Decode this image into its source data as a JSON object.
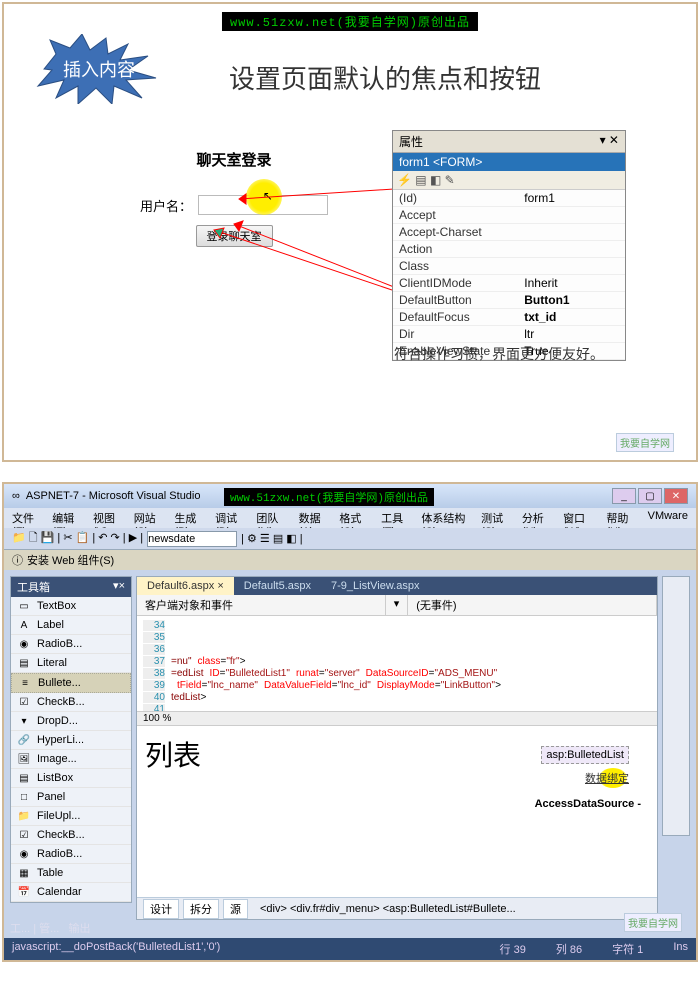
{
  "watermark": "www.51zxw.net(我要自学网)原创出品",
  "card1": {
    "burst": "插入内容",
    "title": "设置页面默认的焦点和按钮",
    "login_head": "聊天室登录",
    "user_label": "用户名：",
    "login_btn": "登录聊天室",
    "note": "符合操作习惯，界面更方便友好。",
    "logo": "我要自学网"
  },
  "props": {
    "title": "属性",
    "pin": "▾ ✕",
    "form": "form1 <FORM>",
    "tool": "⚡ ▤ ◧ ✎",
    "rows": [
      {
        "k": "(Id)",
        "v": "form1"
      },
      {
        "k": "Accept",
        "v": ""
      },
      {
        "k": "Accept-Charset",
        "v": ""
      },
      {
        "k": "Action",
        "v": ""
      },
      {
        "k": "Class",
        "v": ""
      },
      {
        "k": "ClientIDMode",
        "v": "Inherit"
      },
      {
        "k": "DefaultButton",
        "v": "Button1",
        "bold": true
      },
      {
        "k": "DefaultFocus",
        "v": "txt_id",
        "bold": true
      },
      {
        "k": "Dir",
        "v": "ltr"
      },
      {
        "k": "EnableViewState",
        "v": "True"
      }
    ]
  },
  "vs": {
    "title": "ASPNET-7 - Microsoft Visual Studio",
    "menus": [
      "文件(F)",
      "编辑(E)",
      "视图(V)",
      "网站(S)",
      "生成(B)",
      "调试(D)",
      "团队(M)",
      "数据(A)",
      "格式(O)",
      "工具(T)",
      "体系结构(C)",
      "测试(S)",
      "分析(N)",
      "窗口(W)",
      "帮助(H)",
      "VMware"
    ],
    "dropdown": "newsdate",
    "install": "安装 Web 组件(S)",
    "toolbox": "工具箱",
    "tbitems": [
      {
        "i": "▭",
        "t": "TextBox"
      },
      {
        "i": "A",
        "t": "Label"
      },
      {
        "i": "◉",
        "t": "RadioB..."
      },
      {
        "i": "▤",
        "t": "Literal"
      },
      {
        "i": "≡",
        "t": "Bullete...",
        "sel": true
      },
      {
        "i": "☑",
        "t": "CheckB..."
      },
      {
        "i": "▾",
        "t": "DropD..."
      },
      {
        "i": "🔗",
        "t": "HyperLi..."
      },
      {
        "i": "🖼",
        "t": "Image..."
      },
      {
        "i": "▤",
        "t": "ListBox"
      },
      {
        "i": "□",
        "t": "Panel"
      },
      {
        "i": "📁",
        "t": "FileUpl..."
      },
      {
        "i": "☑",
        "t": "CheckB..."
      },
      {
        "i": "◉",
        "t": "RadioB..."
      },
      {
        "i": "▦",
        "t": "Table"
      },
      {
        "i": "📅",
        "t": "Calendar"
      }
    ],
    "tabs": [
      {
        "t": "Default6.aspx",
        "sel": true
      },
      {
        "t": "Default5.aspx"
      },
      {
        "t": "7-9_ListView.aspx"
      }
    ],
    "subhdr": {
      "left": "客户端对象和事件",
      "right": "(无事件)"
    },
    "pct": "100 %",
    "big": "列表",
    "bl": "asp:BulletedList",
    "db": "数据绑定",
    "ads": "AccessDataSource -",
    "btabs": {
      "design": "设计",
      "split": "拆分",
      "src": "源"
    },
    "path": "<div>  <div.fr#div_menu>  <asp:BulletedList#Bullete...",
    "bott_tab": "工... | 管...",
    "output": "输出",
    "jsline": "javascript:__doPostBack('BulletedList1','0')",
    "status": {
      "line": "行 39",
      "col": "列 86",
      "char": "字符 1",
      "ins": "Ins"
    },
    "logo": "我要自学网"
  }
}
